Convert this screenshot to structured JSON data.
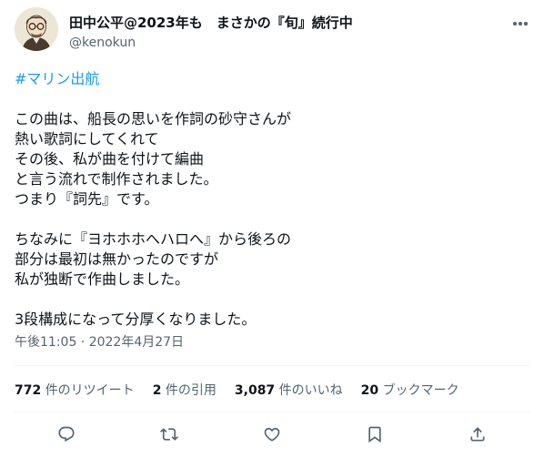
{
  "author": {
    "display_name": "田中公平@2023年も　まさかの『旬』続行中",
    "handle": "@kenokun"
  },
  "tweet": {
    "hashtag": "#マリン出航",
    "lines": [
      "この曲は、船長の思いを作詞の砂守さんが",
      "熱い歌詞にしてくれて",
      "その後、私が曲を付けて編曲",
      "と言う流れで制作されました。",
      "つまり『詞先』です。",
      "",
      "ちなみに『ヨホホホへハロへ』から後ろの",
      "部分は最初は無かったのですが",
      "私が独断で作曲しました。",
      "",
      "3段構成になって分厚くなりました。"
    ],
    "timestamp": "午後11:05 · 2022年4月27日"
  },
  "stats": {
    "retweets_count": "772",
    "retweets_label": "件のリツイート",
    "quotes_count": "2",
    "quotes_label": "件の引用",
    "likes_count": "3,087",
    "likes_label": "件のいいね",
    "bookmarks_count": "20",
    "bookmarks_label": "ブックマーク"
  },
  "actions": [
    "reply-icon",
    "retweet-icon",
    "like-icon",
    "bookmark-icon",
    "share-icon"
  ],
  "colors": {
    "hashtag": "#1d9bf0",
    "secondary_text": "#536471",
    "divider": "#eff3f4"
  }
}
